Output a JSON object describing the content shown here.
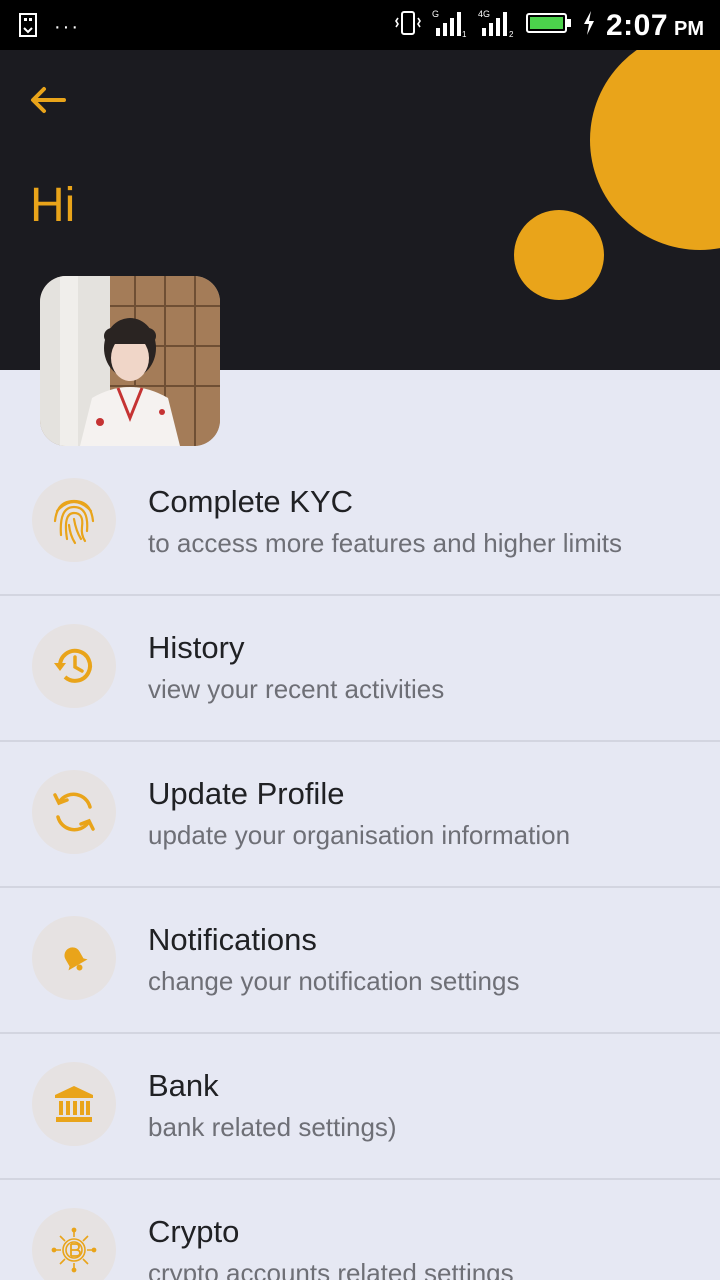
{
  "status_bar": {
    "time": "2:07",
    "ampm": "PM",
    "more_indicator": "···",
    "icons": [
      "usb-debug-icon",
      "vibrate-icon",
      "signal-g-icon",
      "signal-4g-icon",
      "battery-icon",
      "charging-icon"
    ]
  },
  "header": {
    "greeting": "Hi",
    "accent_color": "#e9a41a",
    "background_color": "#1b1b20"
  },
  "menu": [
    {
      "id": "kyc",
      "title": "Complete KYC",
      "subtitle": "to access more features and higher limits",
      "icon": "fingerprint-icon"
    },
    {
      "id": "history",
      "title": "History",
      "subtitle": "view your recent activities",
      "icon": "history-icon"
    },
    {
      "id": "update-profile",
      "title": "Update Profile",
      "subtitle": "update your organisation information",
      "icon": "refresh-icon"
    },
    {
      "id": "notifications",
      "title": "Notifications",
      "subtitle": "change your notification settings",
      "icon": "bell-icon"
    },
    {
      "id": "bank",
      "title": "Bank",
      "subtitle": "bank related settings)",
      "icon": "bank-icon"
    },
    {
      "id": "crypto",
      "title": "Crypto",
      "subtitle": "crypto accounts related settings",
      "icon": "bitcoin-chip-icon"
    }
  ]
}
